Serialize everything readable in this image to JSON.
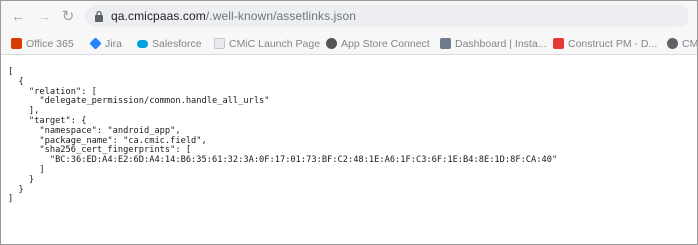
{
  "browser": {
    "url_host": "qa.cmicpaas.com",
    "url_path": "/.well-known/assetlinks.json"
  },
  "bookmarks": [
    {
      "label": "Office 365",
      "icon": "office-icon",
      "color": "#d83b01"
    },
    {
      "label": "Jira",
      "icon": "jira-icon",
      "color": "#2684ff"
    },
    {
      "label": "Salesforce",
      "icon": "salesforce-icon",
      "color": "#00a1e0"
    },
    {
      "label": "CMiC Launch Page",
      "icon": "cmic-icon",
      "color": "#e0e0e0"
    },
    {
      "label": "App Store Connect",
      "icon": "apple-icon",
      "color": "#555555"
    },
    {
      "label": "Dashboard | Insta...",
      "icon": "dashboard-icon",
      "color": "#6d7b8d"
    },
    {
      "label": "Construct PM - D...",
      "icon": "construct-icon",
      "color": "#e53935"
    },
    {
      "label": "CM",
      "icon": "cm-icon",
      "color": "#5f6368"
    }
  ],
  "json_text": "[\n  {\n    \"relation\": [\n      \"delegate_permission/common.handle_all_urls\"\n    ],\n    \"target\": {\n      \"namespace\": \"android_app\",\n      \"package_name\": \"ca.cmic.field\",\n      \"sha256_cert_fingerprints\": [\n        \"BC:36:ED:A4:E2:6D:A4:14:B6:35:61:32:3A:0F:17:01:73:BF:C2:48:1E:A6:1F:C3:6F:1E:B4:8E:1D:8F:CA:40\"\n      ]\n    }\n  }\n]"
}
